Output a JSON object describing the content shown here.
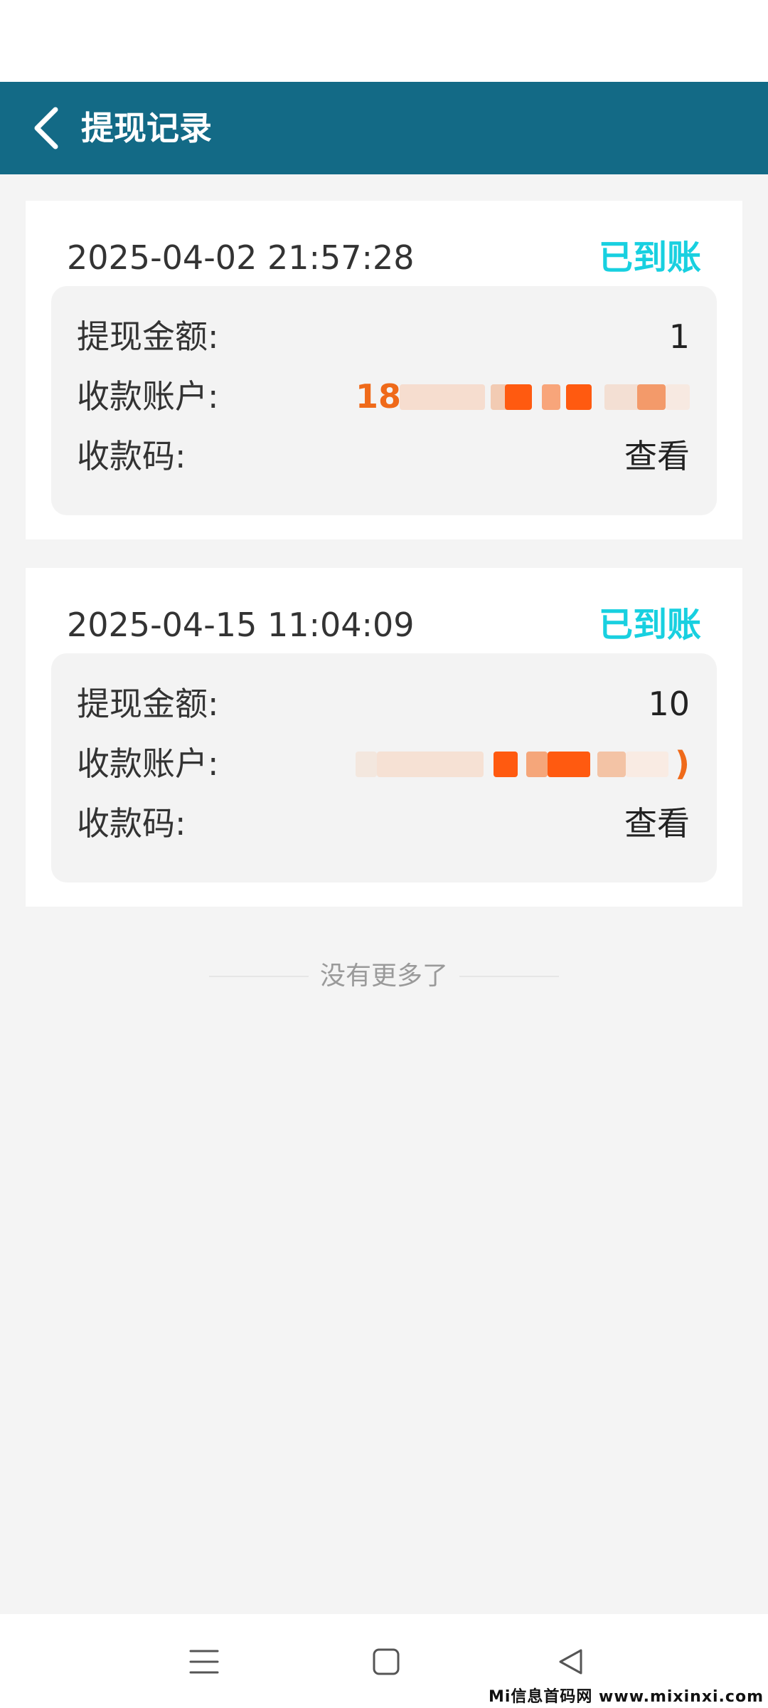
{
  "header": {
    "title": "提现记录"
  },
  "labels": {
    "amount": "提现金额:",
    "account": "收款账户:",
    "code": "收款码:"
  },
  "records": [
    {
      "datetime": "2025-04-02 21:57:28",
      "status": "已到账",
      "amount": "1",
      "account_visible": "18",
      "code_action": "查看"
    },
    {
      "datetime": "2025-04-15 11:04:09",
      "status": "已到账",
      "amount": "10",
      "account_visible": ")",
      "code_action": "查看"
    }
  ],
  "footer": {
    "no_more": "没有更多了"
  },
  "watermark": "Mi信息首码网 www.mixinxi.com",
  "colors": {
    "header_bg": "#136a86",
    "status_color": "#18d0e0",
    "account_color": "#ef6a1a",
    "page_bg": "#f4f4f4"
  },
  "icons": {
    "back": "chevron-left-icon",
    "nav_menu": "menu-icon",
    "nav_home": "square-home-icon",
    "nav_back": "triangle-back-icon"
  }
}
